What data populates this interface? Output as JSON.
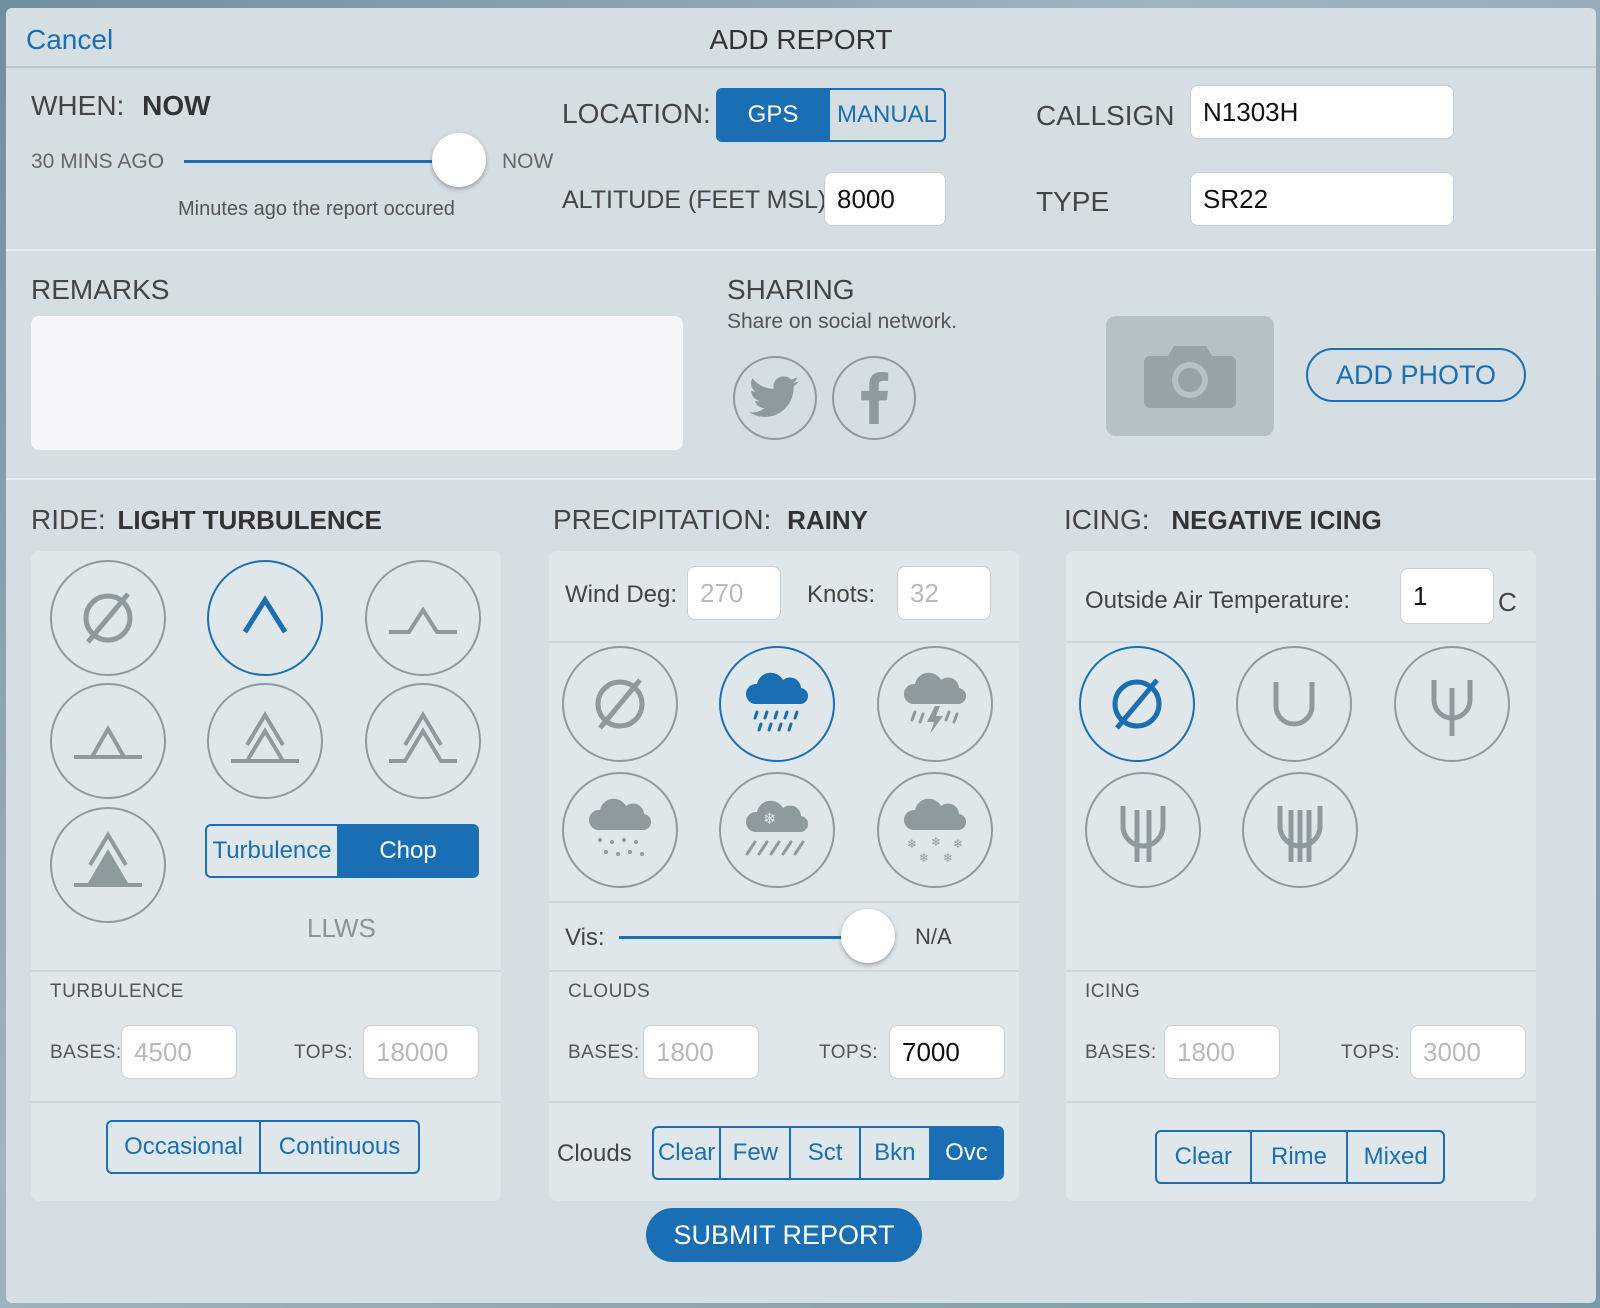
{
  "header": {
    "cancel": "Cancel",
    "title": "ADD REPORT"
  },
  "when": {
    "label": "WHEN:",
    "value": "NOW",
    "min_label": "30 MINS AGO",
    "max_label": "NOW",
    "hint": "Minutes ago the report occured",
    "slider_fraction": 1.0
  },
  "location": {
    "label": "LOCATION:",
    "options": [
      "GPS",
      "MANUAL"
    ],
    "selected": "GPS"
  },
  "altitude": {
    "label": "ALTITUDE (FEET MSL):",
    "value": "8000"
  },
  "callsign": {
    "label": "CALLSIGN",
    "value": "N1303H"
  },
  "type": {
    "label": "TYPE",
    "value": "SR22"
  },
  "remarks": {
    "label": "REMARKS",
    "value": ""
  },
  "sharing": {
    "label": "SHARING",
    "sub": "Share on social network.",
    "icons": [
      "twitter-icon",
      "facebook-icon"
    ]
  },
  "photo": {
    "button": "ADD PHOTO",
    "icon": "camera-icon"
  },
  "ride": {
    "label": "RIDE:",
    "value": "LIGHT TURBULENCE",
    "icons": [
      "none-icon",
      "light-turbulence-icon",
      "light-moderate-icon",
      "moderate-icon",
      "moderate-severe-icon",
      "severe-icon",
      "extreme-icon"
    ],
    "selected": "light-turbulence-icon",
    "mode_options": [
      "Turbulence",
      "Chop"
    ],
    "mode_selected": "Chop",
    "llws": "LLWS",
    "section": "TURBULENCE",
    "bases_label": "BASES:",
    "bases_placeholder": "4500",
    "tops_label": "TOPS:",
    "tops_placeholder": "18000",
    "freq_options": [
      "Occasional",
      "Continuous"
    ]
  },
  "precip": {
    "label": "PRECIPITATION:",
    "value": "RAINY",
    "wind_label": "Wind Deg:",
    "wind_placeholder": "270",
    "knots_label": "Knots:",
    "knots_placeholder": "32",
    "icons": [
      "none-icon",
      "rain-icon",
      "thunderstorm-icon",
      "drizzle-icon",
      "freezing-rain-icon",
      "snow-icon"
    ],
    "selected": "rain-icon",
    "vis_label": "Vis:",
    "vis_value": "N/A",
    "vis_fraction": 1.0,
    "section": "CLOUDS",
    "bases_label": "BASES:",
    "bases_placeholder": "1800",
    "tops_label": "TOPS:",
    "tops_value": "7000",
    "clouds_label": "Clouds",
    "cloud_options": [
      "Clear",
      "Few",
      "Sct",
      "Bkn",
      "Ovc"
    ],
    "cloud_selected": "Ovc"
  },
  "icing": {
    "label": "ICING:",
    "value": "NEGATIVE ICING",
    "oat_label": "Outside Air Temperature:",
    "oat_value": "1",
    "oat_unit": "C",
    "icons": [
      "none-icon",
      "trace-icing-icon",
      "light-icing-icon",
      "moderate-icing-icon",
      "severe-icing-icon"
    ],
    "selected": "none-icon",
    "section": "ICING",
    "bases_label": "BASES:",
    "bases_placeholder": "1800",
    "tops_label": "TOPS:",
    "tops_placeholder": "3000",
    "type_options": [
      "Clear",
      "Rime",
      "Mixed"
    ]
  },
  "submit": "SUBMIT REPORT",
  "colors": {
    "accent": "#1a6fb4",
    "background": "#d4dee3",
    "panel": "#dfe7ea"
  }
}
